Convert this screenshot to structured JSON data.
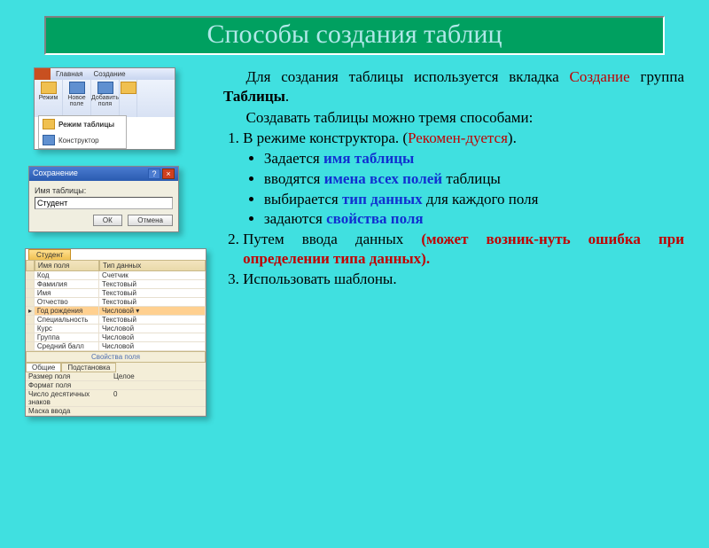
{
  "title": "Способы создания таблиц",
  "body": {
    "intro1_a": "Для создания таблицы используется вкладка ",
    "intro1_b": "Создание",
    "intro1_c": " группа ",
    "intro1_d": "Таблицы",
    "intro1_e": ".",
    "intro2": "Создавать таблицы можно тремя способами:",
    "li1_a": "В режиме конструктора. (",
    "li1_b": "Рекомен-дуется",
    "li1_c": ").",
    "b1_a": "Задается ",
    "b1_b": "имя таблицы",
    "b2_a": "вводятся ",
    "b2_b": "имена всех полей",
    "b2_c": " таблицы",
    "b3_a": "выбирается ",
    "b3_b": "тип данных",
    "b3_c": " для каждого поля",
    "b4_a": "задаются ",
    "b4_b": "свойства поля",
    "li2_a": "Путем ввода данных ",
    "li2_b": "(может возник-нуть ошибка при определении типа данных).",
    "li3": "Использовать шаблоны."
  },
  "ribbon": {
    "tab1": "Главная",
    "tab2": "Создание",
    "btn1": "Режим",
    "btn2": "Новое поле",
    "btn3": "Добавить поля",
    "menu1": "Режим таблицы",
    "menu2": "Конструктор"
  },
  "dialog": {
    "title": "Сохранение",
    "label": "Имя таблицы:",
    "value": "Студент",
    "ok": "ОК",
    "cancel": "Отмена"
  },
  "grid": {
    "tab": "Студент",
    "col1": "Имя поля",
    "col2": "Тип данных",
    "rows": [
      {
        "n": "Код",
        "t": "Счетчик"
      },
      {
        "n": "Фамилия",
        "t": "Текстовый"
      },
      {
        "n": "Имя",
        "t": "Текстовый"
      },
      {
        "n": "Отчество",
        "t": "Текстовый"
      },
      {
        "n": "Год рождения",
        "t": "Числовой"
      },
      {
        "n": "Специальность",
        "t": "Текстовый"
      },
      {
        "n": "Курс",
        "t": "Числовой"
      },
      {
        "n": "Группа",
        "t": "Числовой"
      },
      {
        "n": "Средний балл",
        "t": "Числовой"
      }
    ],
    "props_title": "Свойства поля",
    "ptab1": "Общие",
    "ptab2": "Подстановка",
    "p1": "Размер поля",
    "p1v": "Целое",
    "p2": "Формат поля",
    "p2v": "",
    "p3": "Число десятичных знаков",
    "p3v": "0",
    "p4": "Маска ввода",
    "p4v": ""
  }
}
